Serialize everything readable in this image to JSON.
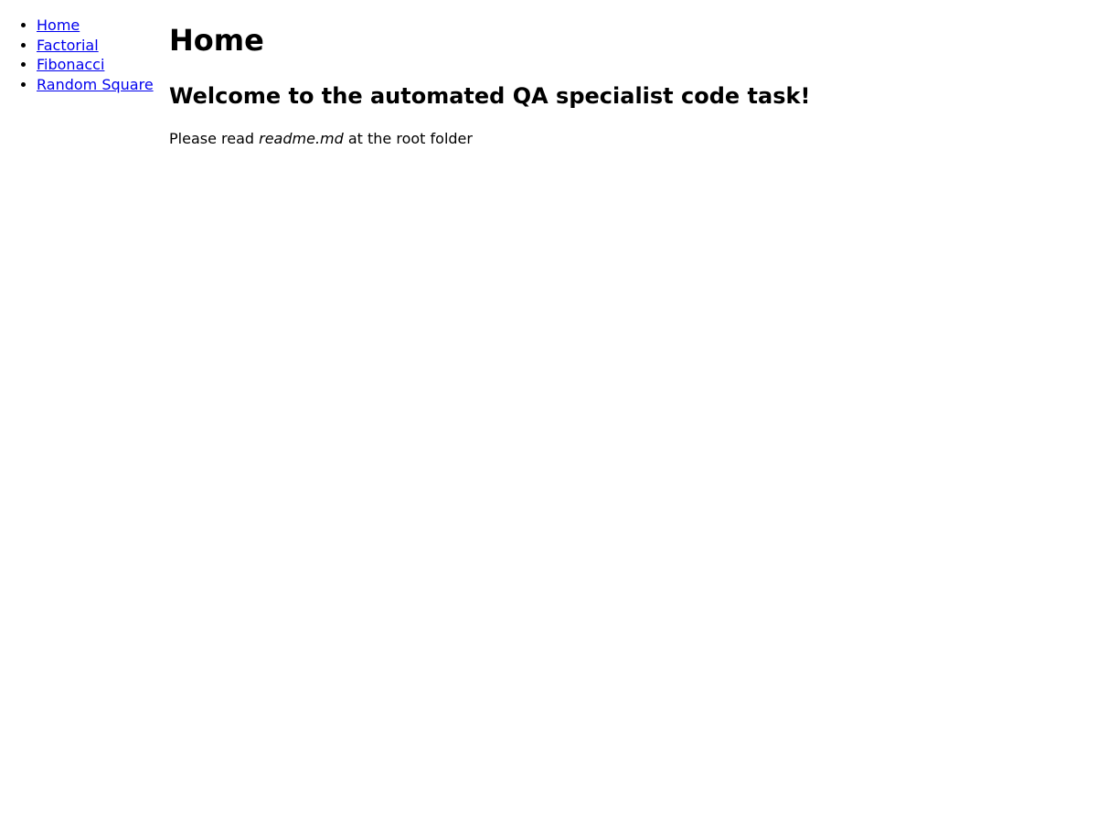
{
  "nav": {
    "items": [
      {
        "label": "Home"
      },
      {
        "label": "Factorial"
      },
      {
        "label": "Fibonacci"
      },
      {
        "label": "Random Square"
      }
    ]
  },
  "main": {
    "title": "Home",
    "welcome": "Welcome to the automated QA specialist code task!",
    "intro": {
      "before": "Please read ",
      "file": "readme.md",
      "after": " at the root folder"
    }
  },
  "colors": {
    "link": "#0000ee",
    "text": "#000000",
    "background": "#ffffff"
  }
}
